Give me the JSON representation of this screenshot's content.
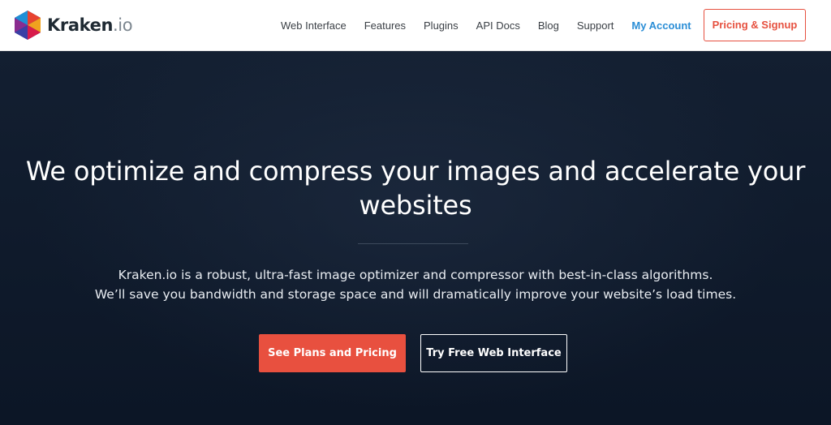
{
  "header": {
    "logo_name": "Kraken",
    "logo_tld": ".io",
    "nav": [
      {
        "label": "Web Interface"
      },
      {
        "label": "Features"
      },
      {
        "label": "Plugins"
      },
      {
        "label": "API Docs"
      },
      {
        "label": "Blog"
      },
      {
        "label": "Support"
      }
    ],
    "account_label": "My Account",
    "signup_label": "Pricing & Signup"
  },
  "hero": {
    "headline_line1": "We optimize and compress your images and accelerate your",
    "headline_line2": "websites",
    "description_line1": "Kraken.io is a robust, ultra-fast image optimizer and compressor with best-in-class algorithms.",
    "description_line2": "We’ll save you bandwidth and storage space and will dramatically improve your website’s load times.",
    "primary_button": "See Plans and Pricing",
    "secondary_button": "Try Free Web Interface"
  },
  "colors": {
    "accent": "#e8503f",
    "link": "#2b8ed6",
    "hero_bg": "#0f1a2b"
  },
  "icons": {
    "logo": "kraken-hexagon-logo-icon"
  }
}
